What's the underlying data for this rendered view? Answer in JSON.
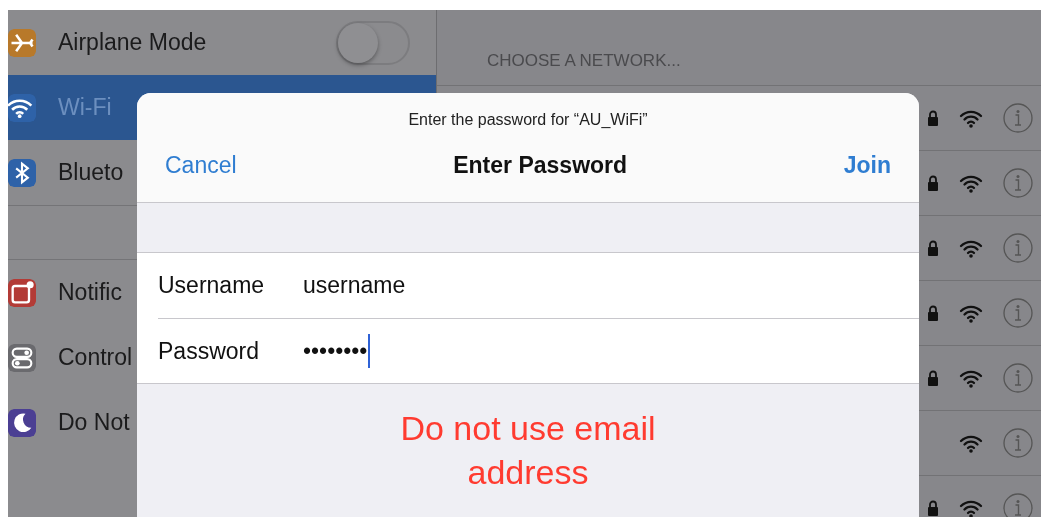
{
  "sidebar": {
    "items": [
      {
        "label": "Airplane Mode",
        "color": "#b8792a",
        "kind": "toggle",
        "on": false,
        "selected": false
      },
      {
        "label": "Wi-Fi",
        "color": "#2e62a8",
        "kind": "plain",
        "selected": true
      },
      {
        "label": "Blueto",
        "color": "#2e62a8",
        "kind": "plain",
        "selected": false
      },
      {
        "label": "Notific",
        "color": "#b33b36",
        "kind": "plain",
        "selected": false,
        "group_start": true
      },
      {
        "label": "Control",
        "color": "#6a6a6e",
        "kind": "plain",
        "selected": false
      },
      {
        "label": "Do Not",
        "color": "#4b3f93",
        "kind": "plain",
        "selected": false
      }
    ]
  },
  "networks": {
    "header": "CHOOSE A NETWORK...",
    "rows": [
      {
        "secured": true
      },
      {
        "secured": true
      },
      {
        "secured": true
      },
      {
        "secured": true
      },
      {
        "secured": true
      },
      {
        "secured": false
      },
      {
        "secured": true
      }
    ]
  },
  "dialog": {
    "message": "Enter the password for “AU_WiFi”",
    "title": "Enter Password",
    "cancel": "Cancel",
    "join": "Join",
    "fields": [
      {
        "label": "Username",
        "value": "username",
        "focused": false
      },
      {
        "label": "Password",
        "value": "••••••••",
        "focused": true
      }
    ],
    "note": "Do not use email address"
  }
}
